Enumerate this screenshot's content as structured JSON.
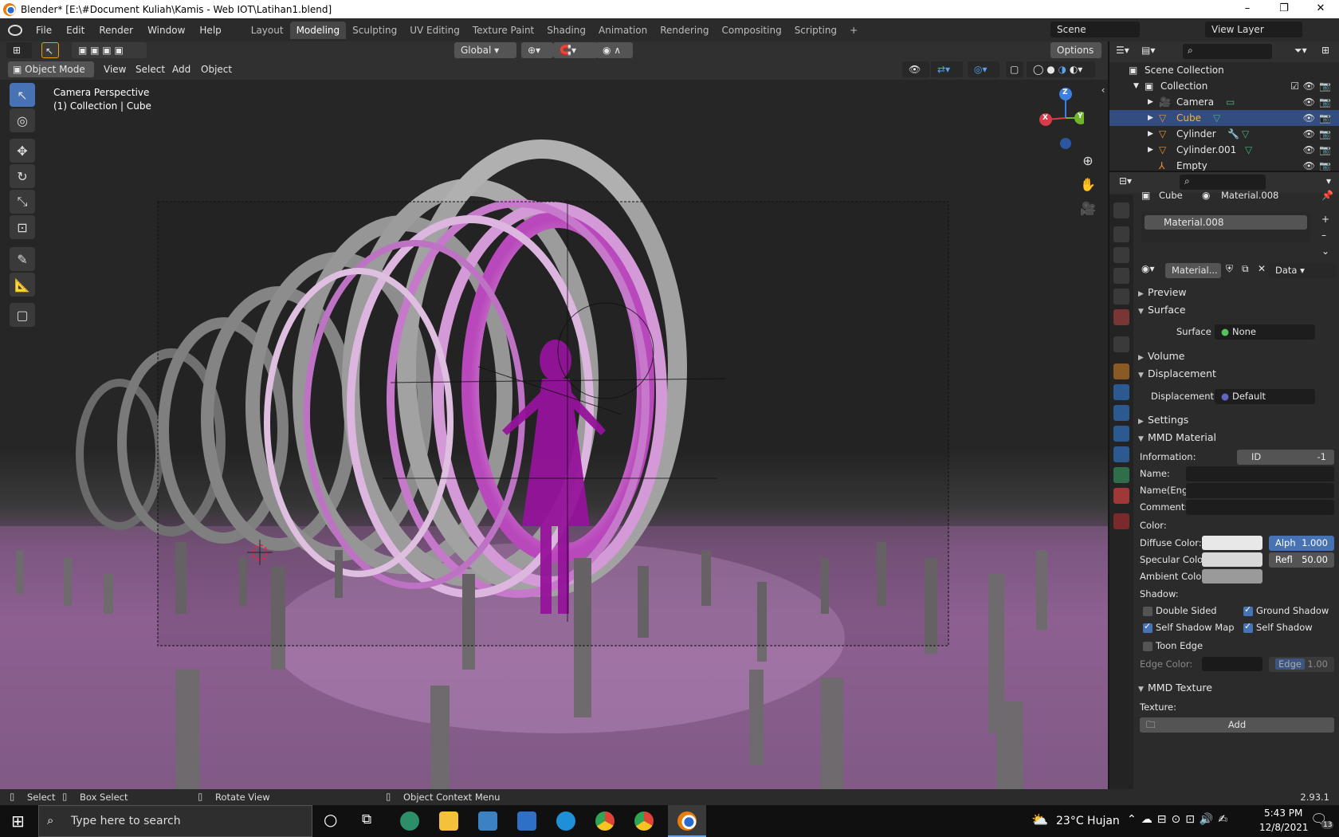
{
  "window": {
    "title": "Blender* [E:\\#Document Kuliah\\Kamis - Web IOT\\Latihan1.blend]",
    "controls": [
      "–",
      "❐",
      "✕"
    ]
  },
  "menubar": {
    "menus": [
      "File",
      "Edit",
      "Render",
      "Window",
      "Help"
    ],
    "workspaces": [
      "Layout",
      "Modeling",
      "Sculpting",
      "UV Editing",
      "Texture Paint",
      "Shading",
      "Animation",
      "Rendering",
      "Compositing",
      "Scripting"
    ],
    "active_workspace": "Modeling",
    "add_tab": "+",
    "scene": "Scene",
    "view_layer": "View Layer"
  },
  "tool_header": {
    "transform_orientation": "Global",
    "options": "Options"
  },
  "view_header": {
    "mode": "Object Mode",
    "menus": [
      "View",
      "Select",
      "Add",
      "Object"
    ]
  },
  "viewport": {
    "camera_label": "Camera Perspective",
    "collection_label": "(1) Collection | Cube",
    "gizmo": {
      "x": "X",
      "y": "Y",
      "z": "Z"
    }
  },
  "outliner": {
    "root": "Scene Collection",
    "collection": "Collection",
    "items": [
      {
        "name": "Camera",
        "selected": false
      },
      {
        "name": "Cube",
        "selected": true
      },
      {
        "name": "Cylinder",
        "selected": false
      },
      {
        "name": "Cylinder.001",
        "selected": false
      },
      {
        "name": "Empty",
        "selected": false
      }
    ]
  },
  "properties": {
    "context_object": "Cube",
    "context_material": "Material.008",
    "slot": "Material.008",
    "material_field": "Material...",
    "link": "Data",
    "panels": {
      "preview": "Preview",
      "surface": "Surface",
      "volume": "Volume",
      "displacement": "Displacement",
      "settings": "Settings",
      "mmd_material": "MMD Material",
      "mmd_texture": "MMD Texture"
    },
    "surface": {
      "label": "Surface",
      "value": "None"
    },
    "displacement": {
      "label": "Displacement",
      "value": "Default"
    },
    "mmd": {
      "information_label": "Information:",
      "id_label": "ID",
      "id_value": "-1",
      "name_label": "Name:",
      "name_value": "",
      "name_eng_label": "Name(Eng):",
      "name_eng_value": "",
      "comment_label": "Comment:",
      "comment_value": "",
      "color_label": "Color:",
      "diffuse_label": "Diffuse Color:",
      "diffuse_color": "#e8e8e8",
      "alpha_label": "Alph",
      "alpha_value": "1.000",
      "specular_label": "Specular Color:",
      "specular_color": "#d8d8d8",
      "refl_label": "Refl",
      "refl_value": "50.00",
      "ambient_label": "Ambient Color:",
      "ambient_color": "#9a9a9a",
      "shadow_label": "Shadow:",
      "double_sided": {
        "label": "Double Sided",
        "checked": false
      },
      "ground_shadow": {
        "label": "Ground Shadow",
        "checked": true
      },
      "self_shadow_map": {
        "label": "Self Shadow Map",
        "checked": true
      },
      "self_shadow": {
        "label": "Self Shadow",
        "checked": true
      },
      "toon_edge": {
        "label": "Toon Edge",
        "checked": false
      },
      "edge_color_label": "Edge Color:",
      "edge_label": "Edge",
      "edge_value": "1.00"
    },
    "texture": {
      "label": "Texture:",
      "add": "Add"
    }
  },
  "statusbar": {
    "select": "Select",
    "box_select": "Box Select",
    "rotate_view": "Rotate View",
    "context_menu": "Object Context Menu",
    "version": "2.93.1"
  },
  "taskbar": {
    "search_placeholder": "Type here to search",
    "weather": "23°C  Hujan",
    "time": "5:43 PM",
    "date": "12/8/2021",
    "notifications": "13"
  },
  "colors": {
    "accent": "#4772b3",
    "selected_row": "#334d80",
    "outliner_active_text": "#ffaf29",
    "background": "#1d1d1d"
  }
}
